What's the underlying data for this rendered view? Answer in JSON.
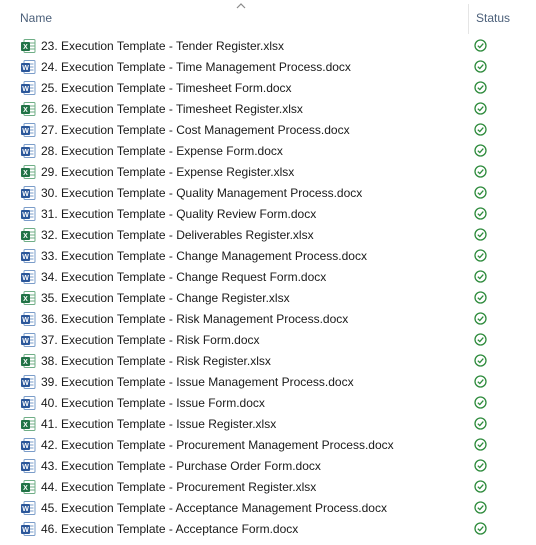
{
  "header": {
    "name_label": "Name",
    "status_label": "Status"
  },
  "icons": {
    "word": "word-doc-icon",
    "excel": "excel-sheet-icon",
    "status": "check-circle-icon"
  },
  "colors": {
    "word": "#2b579a",
    "excel": "#217346",
    "status": "#2e8b3c",
    "header_text": "#4c607a"
  },
  "files": [
    {
      "name": "23. Execution Template - Tender Register.xlsx",
      "type": "excel"
    },
    {
      "name": "24. Execution Template - Time Management Process.docx",
      "type": "word"
    },
    {
      "name": "25. Execution Template - Timesheet Form.docx",
      "type": "word"
    },
    {
      "name": "26. Execution Template - Timesheet Register.xlsx",
      "type": "excel"
    },
    {
      "name": "27. Execution Template - Cost Management Process.docx",
      "type": "word"
    },
    {
      "name": "28. Execution Template - Expense Form.docx",
      "type": "word"
    },
    {
      "name": "29. Execution Template - Expense Register.xlsx",
      "type": "excel"
    },
    {
      "name": "30. Execution Template - Quality Management Process.docx",
      "type": "word"
    },
    {
      "name": "31. Execution Template - Quality Review Form.docx",
      "type": "word"
    },
    {
      "name": "32. Execution Template - Deliverables Register.xlsx",
      "type": "excel"
    },
    {
      "name": "33. Execution Template - Change Management Process.docx",
      "type": "word"
    },
    {
      "name": "34. Execution Template - Change Request Form.docx",
      "type": "word"
    },
    {
      "name": "35. Execution Template - Change Register.xlsx",
      "type": "excel"
    },
    {
      "name": "36. Execution Template - Risk Management Process.docx",
      "type": "word"
    },
    {
      "name": "37. Execution Template - Risk Form.docx",
      "type": "word"
    },
    {
      "name": "38. Execution Template - Risk Register.xlsx",
      "type": "excel"
    },
    {
      "name": "39. Execution Template - Issue Management Process.docx",
      "type": "word"
    },
    {
      "name": "40. Execution Template - Issue Form.docx",
      "type": "word"
    },
    {
      "name": "41. Execution Template - Issue Register.xlsx",
      "type": "excel"
    },
    {
      "name": "42. Execution Template - Procurement Management Process.docx",
      "type": "word"
    },
    {
      "name": "43. Execution Template - Purchase Order Form.docx",
      "type": "word"
    },
    {
      "name": "44. Execution Template - Procurement Register.xlsx",
      "type": "excel"
    },
    {
      "name": "45. Execution Template - Acceptance Management Process.docx",
      "type": "word"
    },
    {
      "name": "46. Execution Template - Acceptance Form.docx",
      "type": "word"
    }
  ]
}
